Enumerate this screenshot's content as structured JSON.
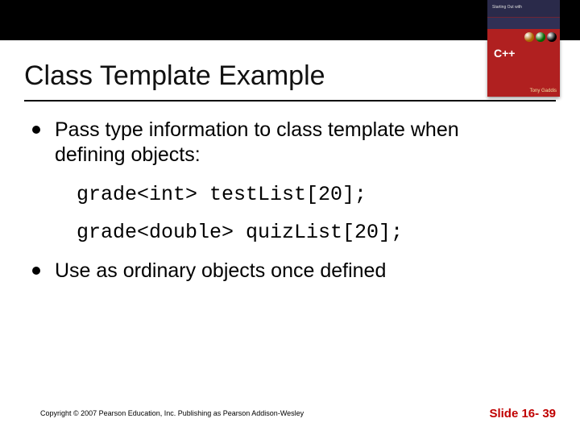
{
  "slide": {
    "title": "Class Template Example"
  },
  "bullets": {
    "b1": "Pass type information to class template when defining objects:",
    "b2": "Use as ordinary objects once defined"
  },
  "code": {
    "line1": "grade<int> testList[20];",
    "line2": "grade<double> quizList[20];"
  },
  "footer": {
    "copyright": "Copyright © 2007 Pearson Education, Inc. Publishing as Pearson Addison-Wesley",
    "slide_number": "Slide 16- 39"
  },
  "cover": {
    "series": "Starting Out with",
    "lang": "C++",
    "author": "Tony Gaddis"
  }
}
